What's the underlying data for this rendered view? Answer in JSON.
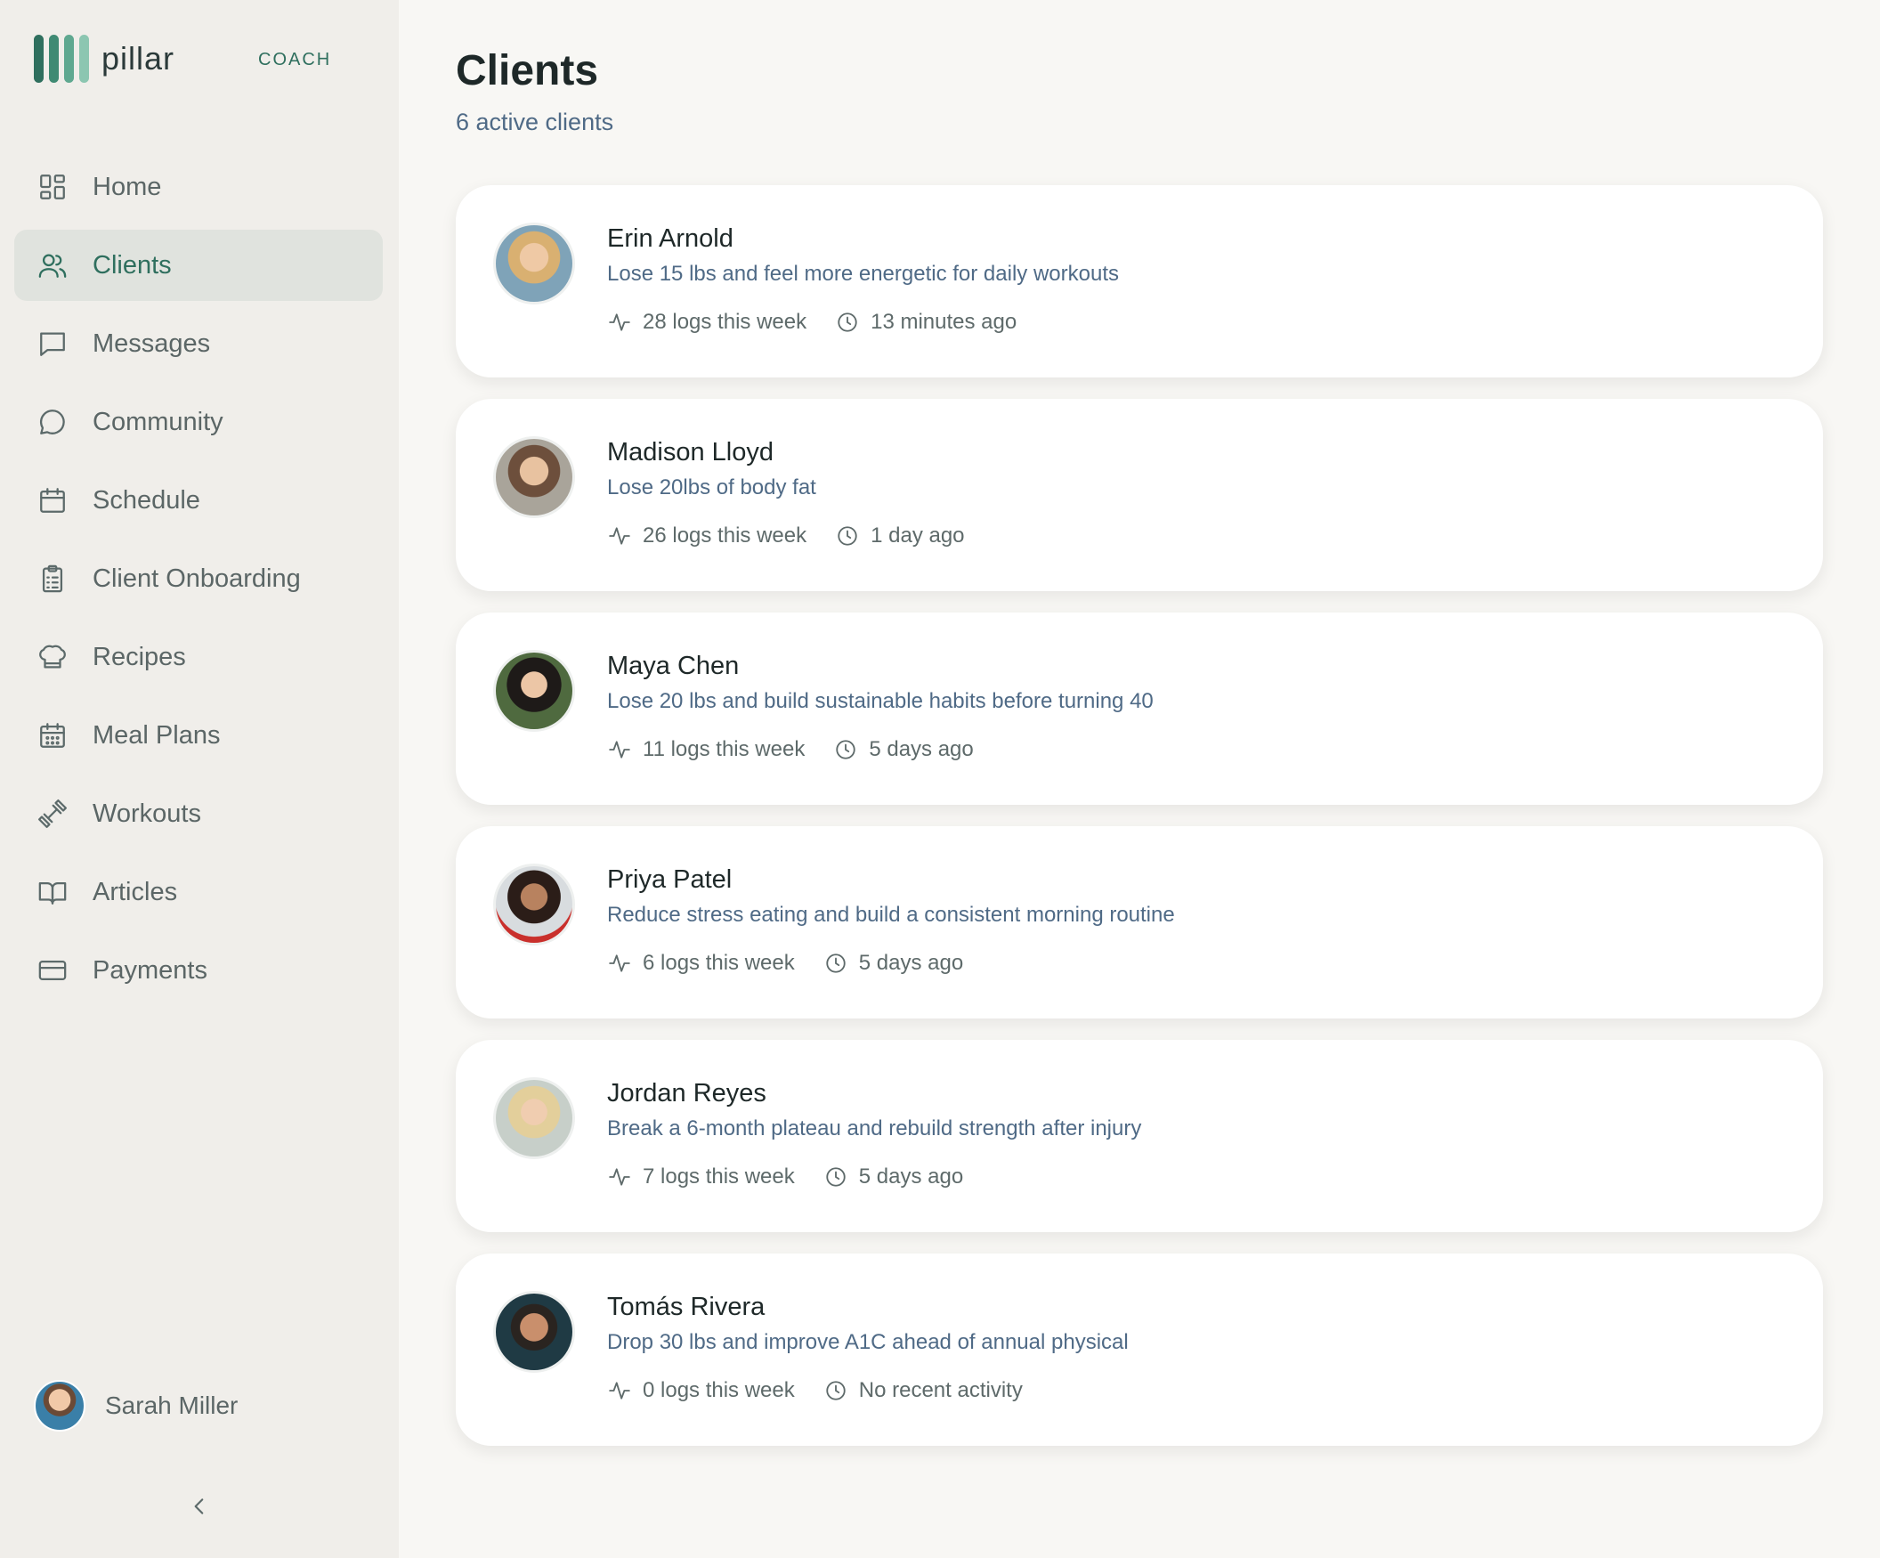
{
  "brand": {
    "name": "pillar",
    "role": "COACH"
  },
  "nav": [
    {
      "label": "Home",
      "icon": "grid-icon",
      "active": false
    },
    {
      "label": "Clients",
      "icon": "users-icon",
      "active": true
    },
    {
      "label": "Messages",
      "icon": "message-square-icon",
      "active": false
    },
    {
      "label": "Community",
      "icon": "chat-bubble-icon",
      "active": false
    },
    {
      "label": "Schedule",
      "icon": "calendar-icon",
      "active": false
    },
    {
      "label": "Client Onboarding",
      "icon": "clipboard-icon",
      "active": false
    },
    {
      "label": "Recipes",
      "icon": "chef-hat-icon",
      "active": false
    },
    {
      "label": "Meal Plans",
      "icon": "calendar-grid-icon",
      "active": false
    },
    {
      "label": "Workouts",
      "icon": "dumbbell-icon",
      "active": false
    },
    {
      "label": "Articles",
      "icon": "book-icon",
      "active": false
    },
    {
      "label": "Payments",
      "icon": "credit-card-icon",
      "active": false
    }
  ],
  "profile": {
    "name": "Sarah Miller"
  },
  "page": {
    "title": "Clients",
    "subtitle": "6 active clients"
  },
  "clients": [
    {
      "name": "Erin Arnold",
      "goal": "Lose 15 lbs and feel more energetic for daily workouts",
      "logs": "28 logs this week",
      "last_active": "13 minutes ago"
    },
    {
      "name": "Madison Lloyd",
      "goal": "Lose 20lbs of body fat",
      "logs": "26 logs this week",
      "last_active": "1 day ago"
    },
    {
      "name": "Maya Chen",
      "goal": "Lose 20 lbs and build sustainable habits before turning 40",
      "logs": "11 logs this week",
      "last_active": "5 days ago"
    },
    {
      "name": "Priya Patel",
      "goal": "Reduce stress eating and build a consistent morning routine",
      "logs": "6 logs this week",
      "last_active": "5 days ago"
    },
    {
      "name": "Jordan Reyes",
      "goal": "Break a 6-month plateau and rebuild strength after injury",
      "logs": "7 logs this week",
      "last_active": "5 days ago"
    },
    {
      "name": "Tomás Rivera",
      "goal": "Drop 30 lbs and improve A1C ahead of annual physical",
      "logs": "0 logs this week",
      "last_active": "No recent activity"
    }
  ],
  "colors": {
    "accent": "#2f6f5e",
    "sidebar_bg": "#f0eeea",
    "page_bg": "#f8f7f4",
    "goal_text": "#4f6a86"
  }
}
